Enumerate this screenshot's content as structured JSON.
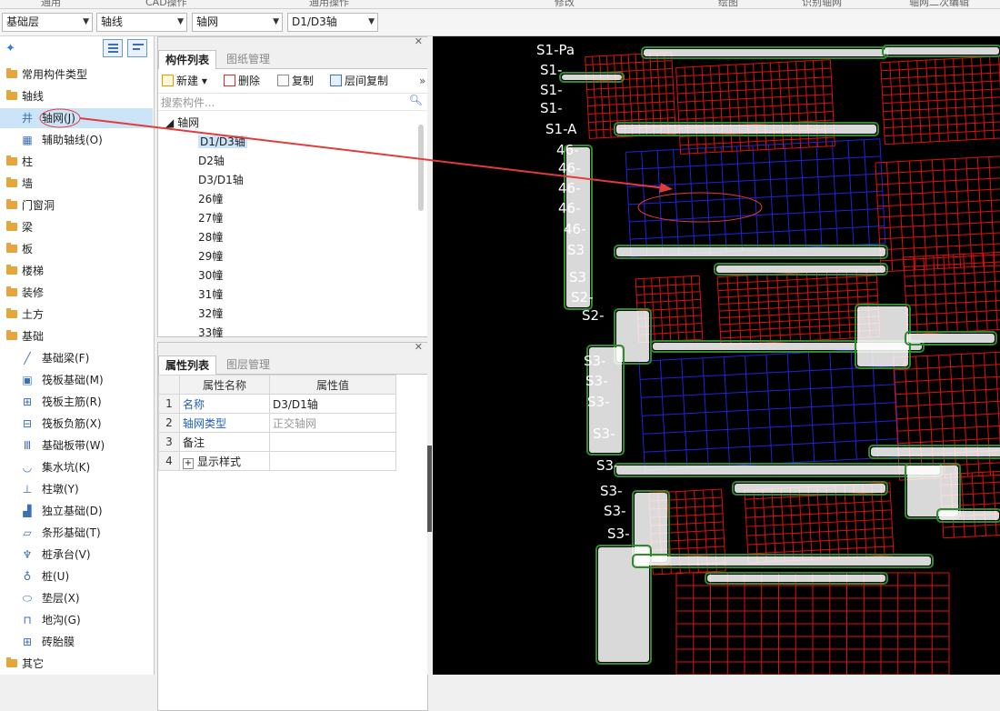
{
  "ribbon": {
    "items": [
      "通用",
      "CAD操作",
      "通用操作",
      "修改",
      "绘图",
      "识别轴网",
      "轴网二次编辑"
    ]
  },
  "toolbar": {
    "floor": "基础层",
    "category": "轴线",
    "type": "轴网",
    "element": "D1/D3轴"
  },
  "left_tree": {
    "items": [
      {
        "label": "常用构件类型",
        "kind": "folder"
      },
      {
        "label": "轴线",
        "kind": "folder"
      },
      {
        "label": "轴网(J)",
        "kind": "sub",
        "icon": "grid-axis-icon",
        "selected": true
      },
      {
        "label": "辅助轴线(O)",
        "kind": "sub",
        "icon": "auxiliary-axis-icon"
      },
      {
        "label": "柱",
        "kind": "folder"
      },
      {
        "label": "墙",
        "kind": "folder"
      },
      {
        "label": "门窗洞",
        "kind": "folder"
      },
      {
        "label": "梁",
        "kind": "folder"
      },
      {
        "label": "板",
        "kind": "folder"
      },
      {
        "label": "楼梯",
        "kind": "folder"
      },
      {
        "label": "装修",
        "kind": "folder"
      },
      {
        "label": "土方",
        "kind": "folder"
      },
      {
        "label": "基础",
        "kind": "folder"
      },
      {
        "label": "基础梁(F)",
        "kind": "sub",
        "icon": "foundation-beam-icon"
      },
      {
        "label": "筏板基础(M)",
        "kind": "sub",
        "icon": "raft-foundation-icon"
      },
      {
        "label": "筏板主筋(R)",
        "kind": "sub",
        "icon": "raft-main-rebar-icon"
      },
      {
        "label": "筏板负筋(X)",
        "kind": "sub",
        "icon": "raft-negative-rebar-icon"
      },
      {
        "label": "基础板带(W)",
        "kind": "sub",
        "icon": "foundation-strip-icon"
      },
      {
        "label": "集水坑(K)",
        "kind": "sub",
        "icon": "sump-pit-icon"
      },
      {
        "label": "柱墩(Y)",
        "kind": "sub",
        "icon": "column-pier-icon"
      },
      {
        "label": "独立基础(D)",
        "kind": "sub",
        "icon": "isolated-footing-icon"
      },
      {
        "label": "条形基础(T)",
        "kind": "sub",
        "icon": "strip-footing-icon"
      },
      {
        "label": "桩承台(V)",
        "kind": "sub",
        "icon": "pile-cap-icon"
      },
      {
        "label": "桩(U)",
        "kind": "sub",
        "icon": "pile-icon"
      },
      {
        "label": "垫层(X)",
        "kind": "sub",
        "icon": "cushion-layer-icon"
      },
      {
        "label": "地沟(G)",
        "kind": "sub",
        "icon": "trench-icon"
      },
      {
        "label": "砖胎膜",
        "kind": "sub",
        "icon": "brick-mold-icon"
      },
      {
        "label": "其它",
        "kind": "folder"
      }
    ]
  },
  "component_panel": {
    "tabs": [
      "构件列表",
      "图纸管理"
    ],
    "actions": {
      "new": "新建",
      "delete": "删除",
      "copy": "复制",
      "floor_copy": "层间复制"
    },
    "search_placeholder": "搜索构件...",
    "root": "轴网",
    "items": [
      "D1/D3轴",
      "D2轴",
      "D3/D1轴",
      "26幢",
      "27幢",
      "28幢",
      "29幢",
      "30幢",
      "31幢",
      "32幢",
      "33幢"
    ]
  },
  "property_panel": {
    "tabs": [
      "属性列表",
      "图层管理"
    ],
    "headers": {
      "name": "属性名称",
      "value": "属性值"
    },
    "rows": [
      {
        "num": "1",
        "name": "名称",
        "value": "D3/D1轴"
      },
      {
        "num": "2",
        "name": "轴网类型",
        "value": "正交轴网"
      },
      {
        "num": "3",
        "name": "备注",
        "value": ""
      },
      {
        "num": "4",
        "name": "显示样式",
        "value": ""
      }
    ]
  },
  "canvas_labels": [
    "S1-Pa",
    "S1-",
    "S1-",
    "S1-",
    "S1-A",
    "46-",
    "46-",
    "46-",
    "46-",
    "46-",
    "S3",
    "S3",
    "S2-",
    "S2-",
    "S3-",
    "S3-",
    "S3-",
    "S3-",
    "S3-",
    "S3-",
    "S3-",
    "S3-"
  ],
  "colors": {
    "selection": "#cce4f7",
    "grid_red": "#e01010",
    "grid_blue": "#2222dd",
    "annotation": "#e33b3b",
    "accent": "#1f5fbf"
  }
}
